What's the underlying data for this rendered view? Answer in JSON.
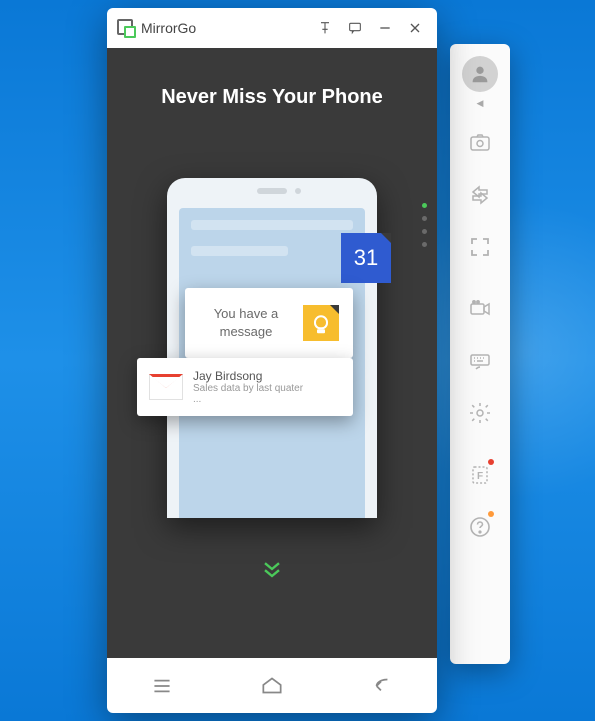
{
  "app": {
    "title": "MirrorGo"
  },
  "hero": {
    "title": "Never Miss Your Phone"
  },
  "calendar": {
    "day": "31"
  },
  "message_card": {
    "line1": "You have a",
    "line2": "message"
  },
  "gmail": {
    "from": "Jay Birdsong",
    "subject": "Sales data by last quater",
    "ellipsis": "..."
  },
  "sidebar": {
    "items": [
      {
        "name": "camera-icon"
      },
      {
        "name": "transfer-icon"
      },
      {
        "name": "fullscreen-icon"
      },
      {
        "name": "record-icon"
      },
      {
        "name": "keyboard-icon"
      },
      {
        "name": "settings-icon"
      },
      {
        "name": "form-icon"
      },
      {
        "name": "help-icon"
      }
    ]
  }
}
